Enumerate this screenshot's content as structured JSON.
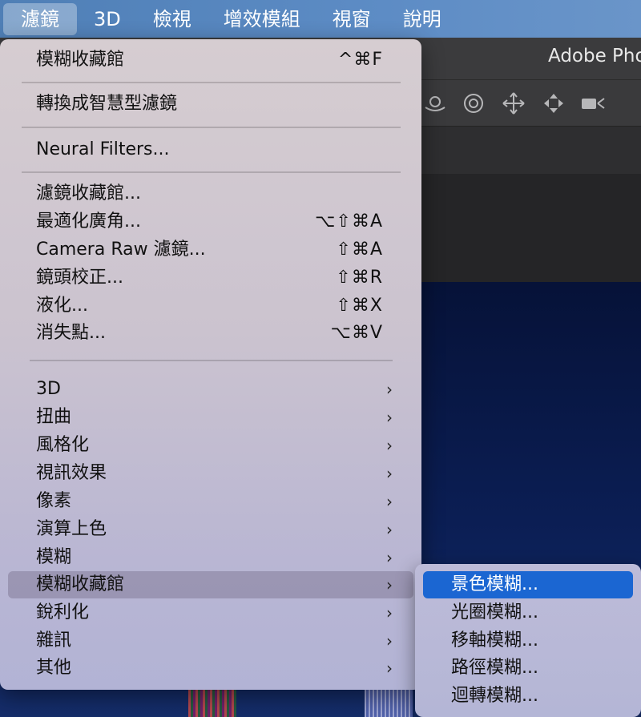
{
  "menubar": {
    "items": [
      {
        "label": "濾鏡",
        "active": true
      },
      {
        "label": "3D",
        "active": false
      },
      {
        "label": "檢視",
        "active": false
      },
      {
        "label": "增效模組",
        "active": false
      },
      {
        "label": "視窗",
        "active": false
      },
      {
        "label": "說明",
        "active": false
      }
    ]
  },
  "app": {
    "title": "Adobe Pho",
    "tool_icons": [
      "orbit-3d-icon",
      "rotate-3d-icon",
      "pan-3d-icon",
      "slide-3d-icon",
      "video-camera-icon"
    ]
  },
  "filter_menu": {
    "group1": {
      "label": "模糊收藏館",
      "shortcut": "^⌘F"
    },
    "group2": {
      "label": "轉換成智慧型濾鏡"
    },
    "group3": {
      "label": "Neural Filters..."
    },
    "group4": [
      {
        "label": "濾鏡收藏館...",
        "shortcut": ""
      },
      {
        "label": "最適化廣角...",
        "shortcut": "⌥⇧⌘A"
      },
      {
        "label": "Camera Raw 濾鏡...",
        "shortcut": "⇧⌘A"
      },
      {
        "label": "鏡頭校正...",
        "shortcut": "⇧⌘R"
      },
      {
        "label": "液化...",
        "shortcut": "⇧⌘X"
      },
      {
        "label": "消失點...",
        "shortcut": "⌥⌘V"
      }
    ],
    "submenus": [
      {
        "label": "3D"
      },
      {
        "label": "扭曲"
      },
      {
        "label": "風格化"
      },
      {
        "label": "視訊效果"
      },
      {
        "label": "像素"
      },
      {
        "label": "演算上色"
      },
      {
        "label": "模糊"
      },
      {
        "label": "模糊收藏館",
        "highlighted": true
      },
      {
        "label": "銳利化"
      },
      {
        "label": "雜訊"
      },
      {
        "label": "其他"
      }
    ],
    "arrow_glyph": "›"
  },
  "blur_gallery_submenu": {
    "items": [
      {
        "label": "景色模糊...",
        "selected": true
      },
      {
        "label": "光圈模糊...",
        "selected": false
      },
      {
        "label": "移軸模糊...",
        "selected": false
      },
      {
        "label": "路徑模糊...",
        "selected": false
      },
      {
        "label": "迴轉模糊...",
        "selected": false
      }
    ]
  },
  "colors": {
    "selection": "#1b66d2",
    "menubar": "#5d8cc5"
  }
}
